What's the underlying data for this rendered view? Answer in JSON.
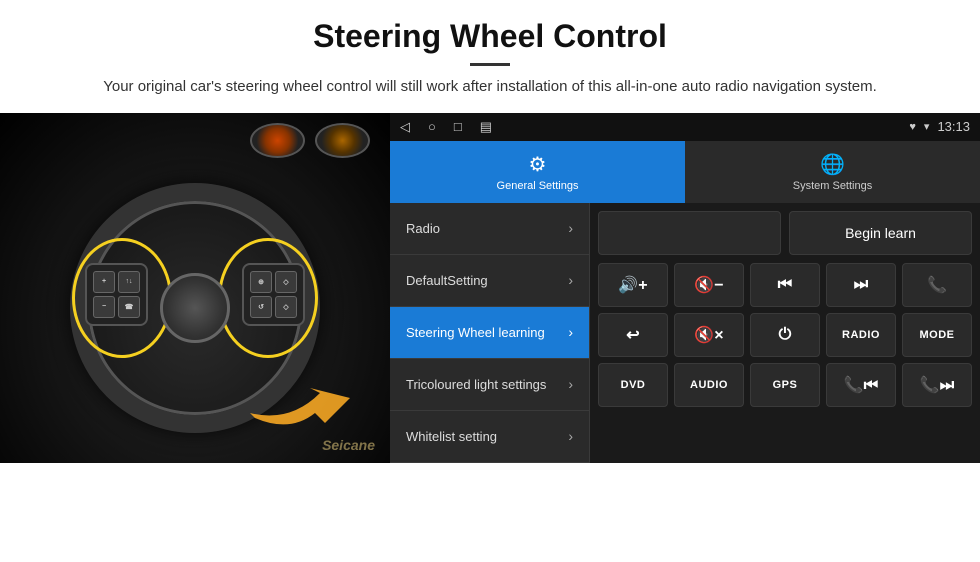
{
  "header": {
    "title": "Steering Wheel Control",
    "divider": true,
    "subtitle": "Your original car's steering wheel control will still work after installation of this all-in-one auto radio navigation system."
  },
  "statusBar": {
    "time": "13:13",
    "navIcons": [
      "◁",
      "○",
      "□",
      "▤"
    ],
    "rightIcons": [
      "♥",
      "▾"
    ]
  },
  "tabs": [
    {
      "id": "general",
      "label": "General Settings",
      "icon": "⚙",
      "active": true
    },
    {
      "id": "system",
      "label": "System Settings",
      "icon": "🌐",
      "active": false
    }
  ],
  "menu": [
    {
      "id": "radio",
      "label": "Radio",
      "active": false
    },
    {
      "id": "default",
      "label": "DefaultSetting",
      "active": false
    },
    {
      "id": "steering",
      "label": "Steering Wheel learning",
      "active": true
    },
    {
      "id": "tricolour",
      "label": "Tricoloured light settings",
      "active": false
    },
    {
      "id": "whitelist",
      "label": "Whitelist setting",
      "active": false
    }
  ],
  "rightPanel": {
    "beginLearnLabel": "Begin learn",
    "buttons": [
      [
        {
          "id": "vol-up",
          "label": "🔊+",
          "type": "icon"
        },
        {
          "id": "vol-down",
          "label": "🔇−",
          "type": "icon"
        },
        {
          "id": "prev",
          "label": "⏮",
          "type": "icon"
        },
        {
          "id": "next",
          "label": "⏭",
          "type": "icon"
        },
        {
          "id": "phone",
          "label": "📞",
          "type": "icon"
        }
      ],
      [
        {
          "id": "hang-up",
          "label": "↩",
          "type": "icon"
        },
        {
          "id": "mute",
          "label": "🔇×",
          "type": "icon"
        },
        {
          "id": "power",
          "label": "⏻",
          "type": "icon"
        },
        {
          "id": "radio-btn",
          "label": "RADIO",
          "type": "text"
        },
        {
          "id": "mode",
          "label": "MODE",
          "type": "text"
        }
      ],
      [
        {
          "id": "dvd",
          "label": "DVD",
          "type": "text"
        },
        {
          "id": "audio",
          "label": "AUDIO",
          "type": "text"
        },
        {
          "id": "gps",
          "label": "GPS",
          "type": "text"
        },
        {
          "id": "tel-prev",
          "label": "📞⏮",
          "type": "icon"
        },
        {
          "id": "tel-next",
          "label": "📞⏭",
          "type": "icon"
        }
      ]
    ]
  },
  "watermark": "Seicane"
}
